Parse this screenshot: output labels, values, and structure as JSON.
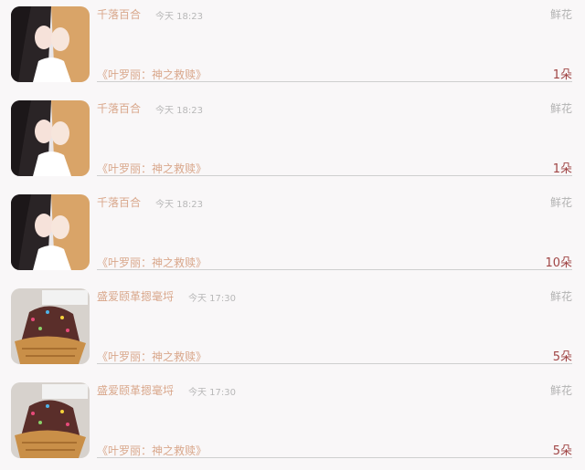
{
  "records": [
    {
      "avatar": "anime-couple-avatar",
      "name": "千落百合",
      "time": "今天 18:23",
      "kind": "鲜花",
      "book": "《叶罗丽：神之救赎》",
      "count": "1朵"
    },
    {
      "avatar": "anime-couple-avatar",
      "name": "千落百合",
      "time": "今天 18:23",
      "kind": "鲜花",
      "book": "《叶罗丽：神之救赎》",
      "count": "1朵"
    },
    {
      "avatar": "anime-couple-avatar",
      "name": "千落百合",
      "time": "今天 18:23",
      "kind": "鲜花",
      "book": "《叶罗丽：神之救赎》",
      "count": "10朵"
    },
    {
      "avatar": "ice-cream-avatar",
      "name": "盛爱颐革摁毫埒",
      "time": "今天 17:30",
      "kind": "鲜花",
      "book": "《叶罗丽：神之救赎》",
      "count": "5朵"
    },
    {
      "avatar": "ice-cream-avatar",
      "name": "盛爱颐革摁毫埒",
      "time": "今天 17:30",
      "kind": "鲜花",
      "book": "《叶罗丽：神之救赎》",
      "count": "5朵"
    }
  ],
  "colors": {
    "name": "#d9a78b",
    "count": "#a04545",
    "muted": "#b8b8b8",
    "divider": "#cfcfcf",
    "background": "#f9f7f8"
  }
}
